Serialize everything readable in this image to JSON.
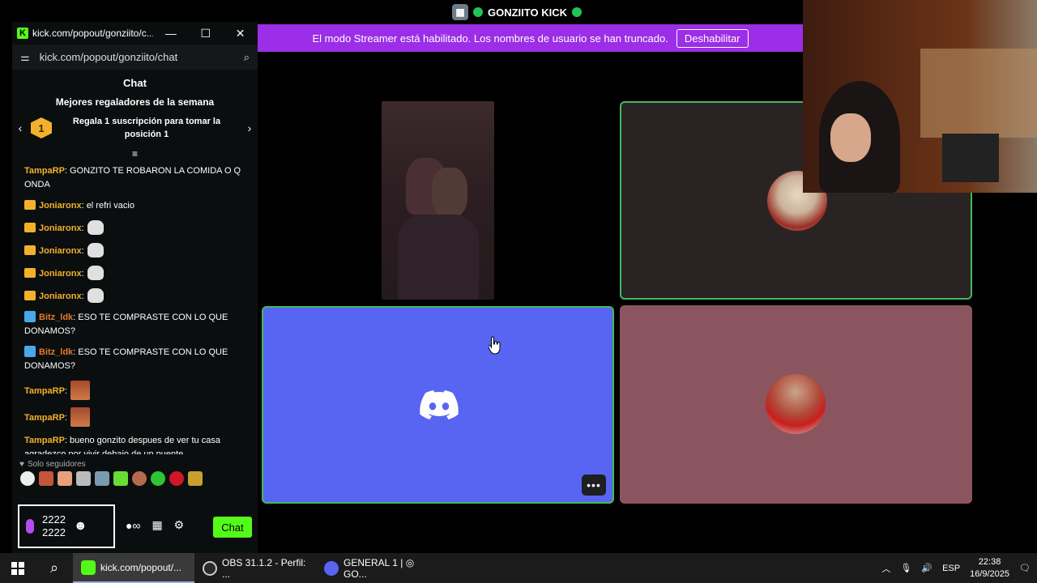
{
  "call": {
    "server_name": "GONZIITO KICK",
    "banner_text": "El modo Streamer está habilitado. Los nombres de usuario se han truncado.",
    "banner_button": "Deshabilitar",
    "more_label": "•••"
  },
  "chat_window": {
    "title": "kick.com/popout/gonziito/c...",
    "url": "kick.com/popout/gonziito/chat",
    "header": "Chat",
    "gifters_title": "Mejores regaladores de la semana",
    "gift_rank": "1",
    "gift_text": "Regala 1 suscripción para tomar la posición 1",
    "followers_only": "Solo seguidores",
    "composer_value_1": "2222",
    "composer_value_2": "2222",
    "send_label": "Chat",
    "messages": [
      {
        "user": "TampaRP",
        "text": ": GONZITO TE ROBARON LA COMIDA O Q ONDA"
      },
      {
        "user": "Joniaronx",
        "text": ": el refri vacio"
      },
      {
        "user": "Joniaronx",
        "text": ":"
      },
      {
        "user": "Joniaronx",
        "text": ":"
      },
      {
        "user": "Joniaronx",
        "text": ":"
      },
      {
        "user": "Joniaronx",
        "text": ":"
      },
      {
        "user": "Bitz_ldk",
        "text": ": ESO TE COMPRASTE CON LO QUE DONAMOS?"
      },
      {
        "user": "Bitz_ldk",
        "text": ": ESO TE COMPRASTE CON LO QUE DONAMOS?"
      },
      {
        "user": "TampaRP",
        "text": ":"
      },
      {
        "user": "TampaRP",
        "text": ":"
      },
      {
        "user": "TampaRP",
        "text": ": bueno gonzito despues de ver tu casa agradezco por vivir debajo de un puente"
      }
    ]
  },
  "taskbar": {
    "apps": [
      {
        "label": "kick.com/popout/...",
        "color": "#53fc18"
      },
      {
        "label": "OBS 31.1.2 - Perfil: ...",
        "color": "#2a2a2a"
      },
      {
        "label": "GENERAL 1 | ◎ GO...",
        "color": "#5865f2"
      }
    ],
    "lang": "ESP",
    "time": "22:38",
    "date": "16/9/2025"
  },
  "colors": {
    "kick_green": "#53fc18",
    "streamer_purple": "#9b2ee6",
    "discord_blurple": "#5865f2",
    "speaking_green": "#43b95f"
  }
}
